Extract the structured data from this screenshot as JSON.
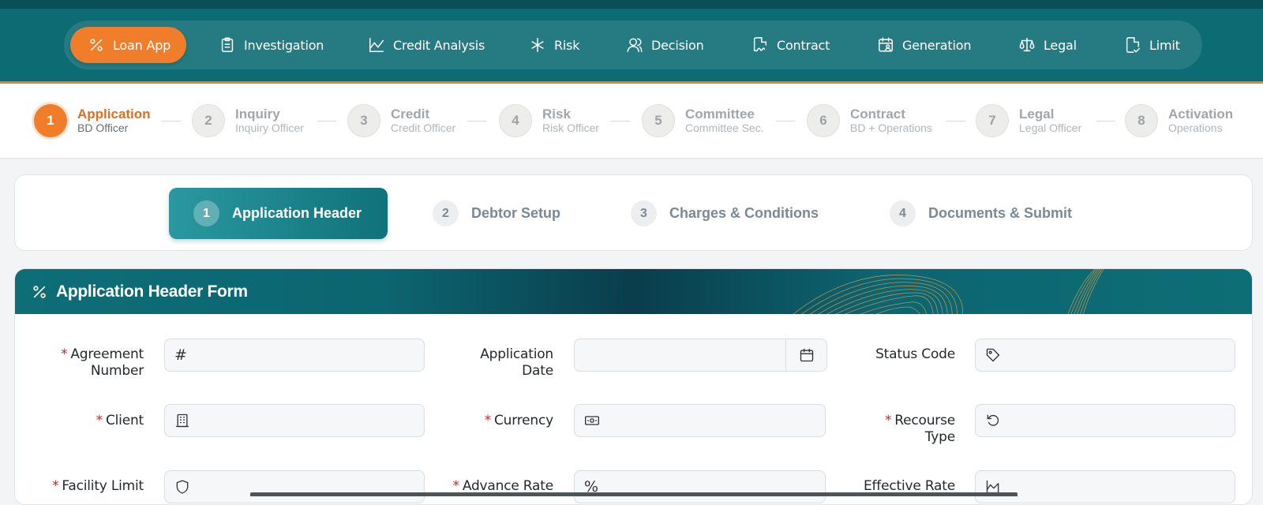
{
  "nav": {
    "items": [
      {
        "label": "Loan App",
        "icon": "percent-icon",
        "active": true
      },
      {
        "label": "Investigation",
        "icon": "clipboard-icon"
      },
      {
        "label": "Credit Analysis",
        "icon": "line-chart-icon"
      },
      {
        "label": "Risk",
        "icon": "asterisk-icon"
      },
      {
        "label": "Decision",
        "icon": "users-icon"
      },
      {
        "label": "Contract",
        "icon": "signature-file-icon"
      },
      {
        "label": "Generation",
        "icon": "calendar-user-icon"
      },
      {
        "label": "Legal",
        "icon": "scale-icon"
      },
      {
        "label": "Limit",
        "icon": "file-check-icon"
      }
    ]
  },
  "stepper": {
    "steps": [
      {
        "num": "1",
        "title": "Application",
        "sub": "BD Officer",
        "active": true
      },
      {
        "num": "2",
        "title": "Inquiry",
        "sub": "Inquiry Officer"
      },
      {
        "num": "3",
        "title": "Credit",
        "sub": "Credit Officer"
      },
      {
        "num": "4",
        "title": "Risk",
        "sub": "Risk Officer"
      },
      {
        "num": "5",
        "title": "Committee",
        "sub": "Committee Sec."
      },
      {
        "num": "6",
        "title": "Contract",
        "sub": "BD + Operations"
      },
      {
        "num": "7",
        "title": "Legal",
        "sub": "Legal Officer"
      },
      {
        "num": "8",
        "title": "Activation",
        "sub": "Operations"
      }
    ]
  },
  "tabs": [
    {
      "num": "1",
      "label": "Application Header",
      "active": true
    },
    {
      "num": "2",
      "label": "Debtor Setup"
    },
    {
      "num": "3",
      "label": "Charges & Conditions"
    },
    {
      "num": "4",
      "label": "Documents & Submit"
    }
  ],
  "form": {
    "title": "Application Header Form",
    "fields": {
      "agreement_number": {
        "label_line1": "Agreement",
        "label_line2": "Number",
        "required": "*",
        "value": "",
        "icon": "hash-icon",
        "glyph": "#"
      },
      "application_date": {
        "label_line1": "Application",
        "label_line2": "Date",
        "value": "",
        "icon": "calendar-icon"
      },
      "status_code": {
        "label": "Status Code",
        "value": "",
        "icon": "tag-icon"
      },
      "client": {
        "label": "Client",
        "required": "*",
        "value": "",
        "icon": "building-icon"
      },
      "currency": {
        "label": "Currency",
        "required": "*",
        "value": "",
        "icon": "banknote-icon"
      },
      "recourse_type": {
        "label_line1": "Recourse",
        "label_line2": "Type",
        "required": "*",
        "value": "",
        "icon": "rotate-ccw-icon"
      },
      "facility_limit": {
        "label": "Facility Limit",
        "required": "*",
        "value": "",
        "icon": "shield-icon"
      },
      "advance_rate": {
        "label": "Advance Rate",
        "required": "*",
        "value": "",
        "icon": "percent-icon",
        "glyph": "%"
      },
      "effective_rate": {
        "label": "Effective Rate",
        "value": "",
        "icon": "area-chart-icon"
      }
    }
  },
  "colors": {
    "primary": "#0d6c73",
    "accent": "#ef7d2a",
    "required": "#d42020"
  }
}
